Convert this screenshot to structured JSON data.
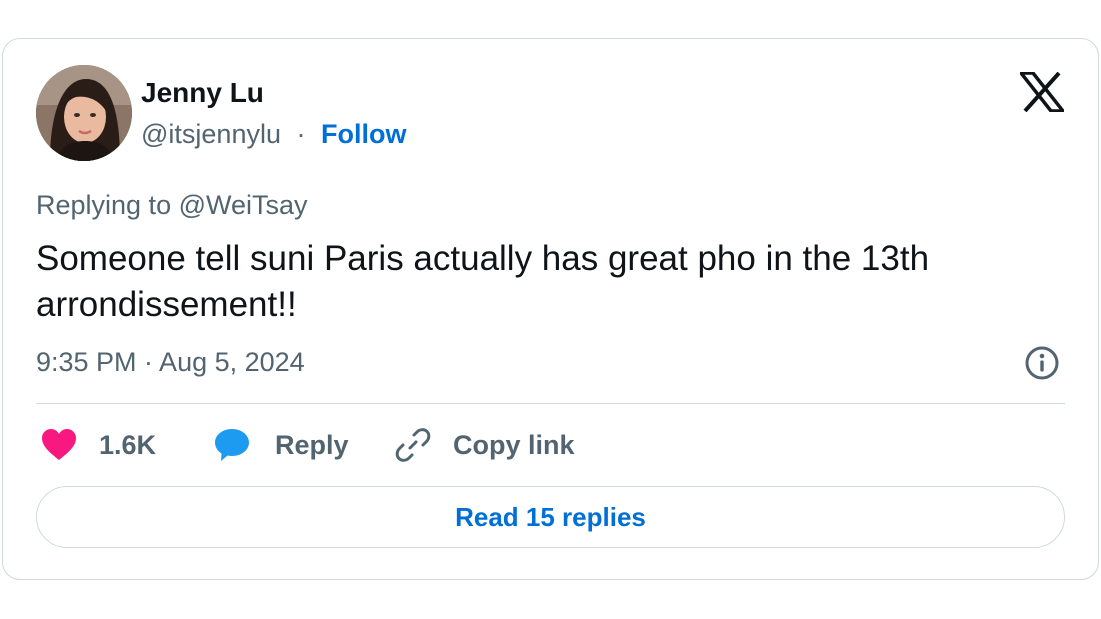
{
  "author": {
    "name": "Jenny Lu",
    "handle": "@itsjennylu",
    "separator": "·",
    "follow_label": "Follow"
  },
  "platform_logo_icon": "x-logo-icon",
  "tweet": {
    "reply_context": "Replying to @WeiTsay",
    "text": "Someone tell suni Paris actually has great pho in the 13th arrondissement!!",
    "timestamp": "9:35 PM · Aug 5, 2024"
  },
  "actions": {
    "likes_count": "1.6K",
    "reply_label": "Reply",
    "copy_link_label": "Copy link"
  },
  "read_replies_label": "Read 15 replies",
  "colors": {
    "accent_blue": "#006fd6",
    "heart_pink": "#f91880",
    "reply_bubble_blue": "#1d9bf0",
    "secondary_text": "#536471",
    "primary_text": "#0f1419",
    "border": "#cfd9de"
  }
}
